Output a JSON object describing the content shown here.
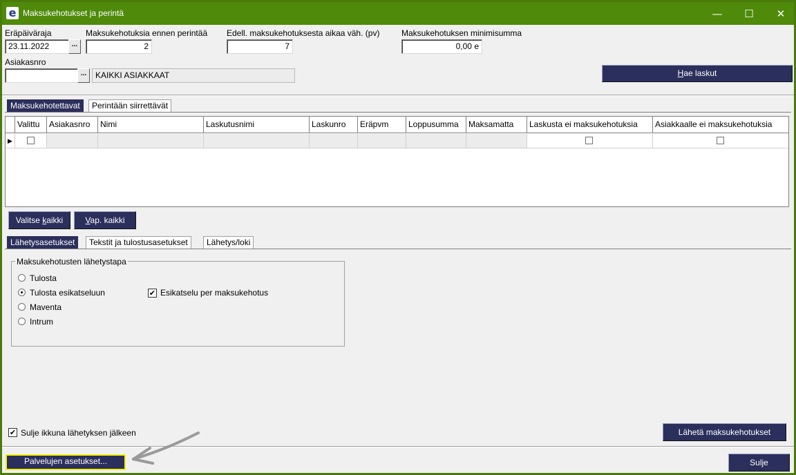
{
  "window": {
    "title": "Maksukehotukset ja perintä",
    "icon_letter": "e",
    "minimize_glyph": "—",
    "maximize_glyph": "☐",
    "close_glyph": "✕"
  },
  "filters": {
    "due_date_label": "Eräpäiväraja",
    "due_date_value": "23.11.2022",
    "reminders_before_label": "Maksukehotuksia ennen perintää",
    "reminders_before_value": "2",
    "days_since_label": "Edell. maksukehotuksesta aikaa väh. (pv)",
    "days_since_value": "7",
    "min_sum_label": "Maksukehotuksen minimisumma",
    "min_sum_value": "0,00 e",
    "customer_no_label": "Asiakasnro",
    "customer_no_value": "",
    "customer_name_value": "KAIKKI ASIAKKAAT",
    "dots": "..."
  },
  "fetch_button": {
    "prefix": "",
    "underlined": "H",
    "rest": "ae laskut"
  },
  "top_tabs": [
    "Maksukehotettavat",
    "Perintään siirrettävät"
  ],
  "grid": {
    "columns": [
      "Valittu",
      "Asiakasnro",
      "Nimi",
      "Laskutusnimi",
      "Laskunro",
      "Eräpvm",
      "Loppusumma",
      "Maksamatta",
      "Laskusta ei maksukehotuksia",
      "Asiakkaalle ei maksukehotuksia"
    ],
    "row_marker": "▶"
  },
  "select_all_button": {
    "prefix": "Valitse ",
    "underlined": "k",
    "rest": "aikki"
  },
  "deselect_all_button": {
    "prefix": "",
    "underlined": "V",
    "rest": "ap. kaikki"
  },
  "bottom_tabs": [
    "Lähetysasetukset",
    "Tekstit ja tulostusasetukset",
    "Lähetys/loki"
  ],
  "send_method": {
    "group_title": "Maksukehotusten lähetystapa",
    "options": [
      "Tulosta",
      "Tulosta esikatseluun",
      "Maventa",
      "Intrum"
    ],
    "selected_option": "Tulosta esikatseluun",
    "preview_per_reminder_label": "Esikatselu per maksukehotus",
    "preview_per_reminder_checked": true
  },
  "close_after_send_label": "Sulje ikkuna lähetyksen jälkeen",
  "close_after_send_checked": true,
  "send_button": "Lähetä maksukehotukset",
  "service_settings_button": "Palvelujen asetukset...",
  "close_button": "Sulje",
  "check_glyph": "✔",
  "colors": {
    "titlebar": "#4f8a0b",
    "navy_button": "#2b2f5c",
    "highlight": "#f5f000"
  }
}
